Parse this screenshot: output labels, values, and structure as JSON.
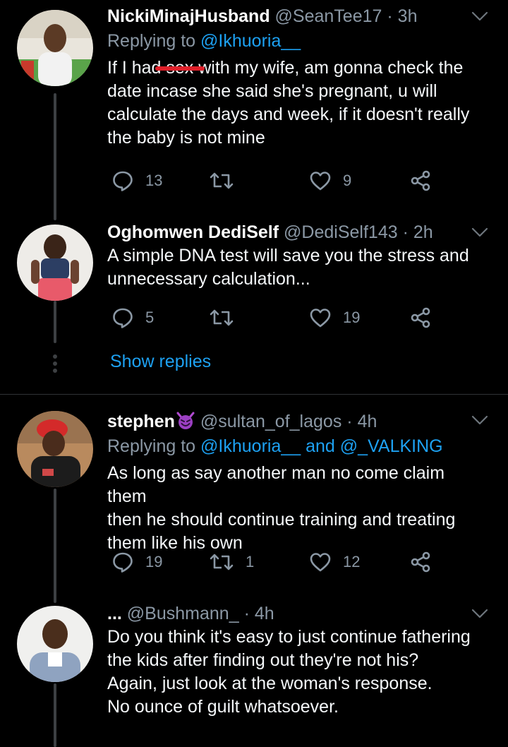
{
  "tweets": [
    {
      "name": "NickiMinajHusband",
      "handle": "@SeanTee17",
      "time": "3h",
      "reply_prefix": "Replying to",
      "mention1": "@Ikhuoria__",
      "lines": [
        "If I had sex with my wife, am gonna check the",
        "date incase she said she's pregnant, u will",
        "calculate the days and week, if it doesn't really",
        "the baby is not mine"
      ],
      "replies": "13",
      "retweets": "",
      "likes": "9"
    },
    {
      "name": "Oghomwen DediSelf",
      "handle": "@DediSelf143",
      "time": "2h",
      "lines": [
        "A simple DNA test will save you the stress and",
        "unnecessary calculation..."
      ],
      "replies": "5",
      "retweets": "",
      "likes": "19"
    },
    {
      "name": "stephen",
      "name_emoji": "devil-emoji",
      "handle": "@sultan_of_lagos",
      "time": "4h",
      "reply_prefix": "Replying to",
      "mention1": "@Ikhuoria__",
      "and_word": "and",
      "mention2": "@_VALKING",
      "lines": [
        "As long as say another man no come claim them",
        "then he should continue training and treating",
        "them like his own"
      ],
      "replies": "19",
      "retweets": "1",
      "likes": "12"
    },
    {
      "name": "...",
      "handle": "@Bushmann_",
      "time": "4h",
      "lines": [
        "Do you think it's easy to just continue fathering",
        "the kids after finding out they're not his?",
        "Again, just look at the woman's response.",
        "No ounce of guilt whatsoever."
      ]
    }
  ],
  "show_replies": "Show replies",
  "separator": "·",
  "icons": {
    "reply": "reply-icon",
    "retweet": "retweet-icon",
    "like": "heart-icon",
    "share": "share-icon",
    "more": "chevron-down-icon"
  },
  "colors": {
    "background": "#000000",
    "text": "#e7e9ea",
    "muted": "#8b98a5",
    "accent": "#1da1f2",
    "redaction": "#e0202a"
  }
}
